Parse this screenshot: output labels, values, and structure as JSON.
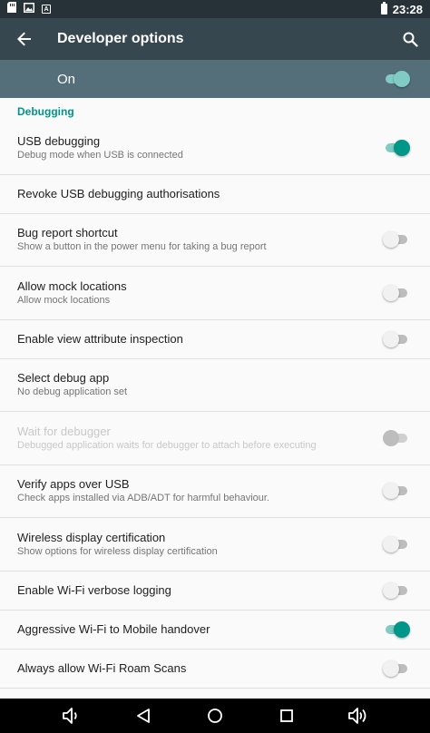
{
  "status_bar": {
    "time": "23:28",
    "notification_icons": [
      "sd-card-icon",
      "image-icon",
      "text-notification-icon"
    ],
    "notification_glyph": "A"
  },
  "app_bar": {
    "title": "Developer options"
  },
  "master": {
    "label": "On",
    "checked": true
  },
  "category": "Debugging",
  "items": [
    {
      "title": "USB debugging",
      "summary": "Debug mode when USB is connected",
      "toggle": true,
      "checked": true,
      "enabled": true
    },
    {
      "title": "Revoke USB debugging authorisations",
      "summary": "",
      "toggle": false,
      "enabled": true
    },
    {
      "title": "Bug report shortcut",
      "summary": "Show a button in the power menu for taking a bug report",
      "toggle": true,
      "checked": false,
      "enabled": true
    },
    {
      "title": "Allow mock locations",
      "summary": "Allow mock locations",
      "toggle": true,
      "checked": false,
      "enabled": true
    },
    {
      "title": "Enable view attribute inspection",
      "summary": "",
      "toggle": true,
      "checked": false,
      "enabled": true
    },
    {
      "title": "Select debug app",
      "summary": "No debug application set",
      "toggle": false,
      "enabled": true
    },
    {
      "title": "Wait for debugger",
      "summary": "Debugged application waits for debugger to attach before executing",
      "toggle": true,
      "checked": false,
      "enabled": false
    },
    {
      "title": "Verify apps over USB",
      "summary": "Check apps installed via ADB/ADT for harmful behaviour.",
      "toggle": true,
      "checked": false,
      "enabled": true
    },
    {
      "title": "Wireless display certification",
      "summary": "Show options for wireless display certification",
      "toggle": true,
      "checked": false,
      "enabled": true
    },
    {
      "title": "Enable Wi-Fi verbose logging",
      "summary": "",
      "toggle": true,
      "checked": false,
      "enabled": true
    },
    {
      "title": "Aggressive Wi-Fi to Mobile handover",
      "summary": "",
      "toggle": true,
      "checked": true,
      "enabled": true
    },
    {
      "title": "Always allow Wi-Fi Roam Scans",
      "summary": "",
      "toggle": true,
      "checked": false,
      "enabled": true
    }
  ],
  "nav_bar": {
    "buttons": [
      "volume-down-icon",
      "back-triangle-icon",
      "home-circle-icon",
      "recents-square-icon",
      "volume-up-icon"
    ]
  },
  "colors": {
    "status_bar": "#263238",
    "app_bar": "#37474f",
    "master_bar": "#546e7a",
    "accent": "#009688",
    "category_text": "#009688"
  }
}
